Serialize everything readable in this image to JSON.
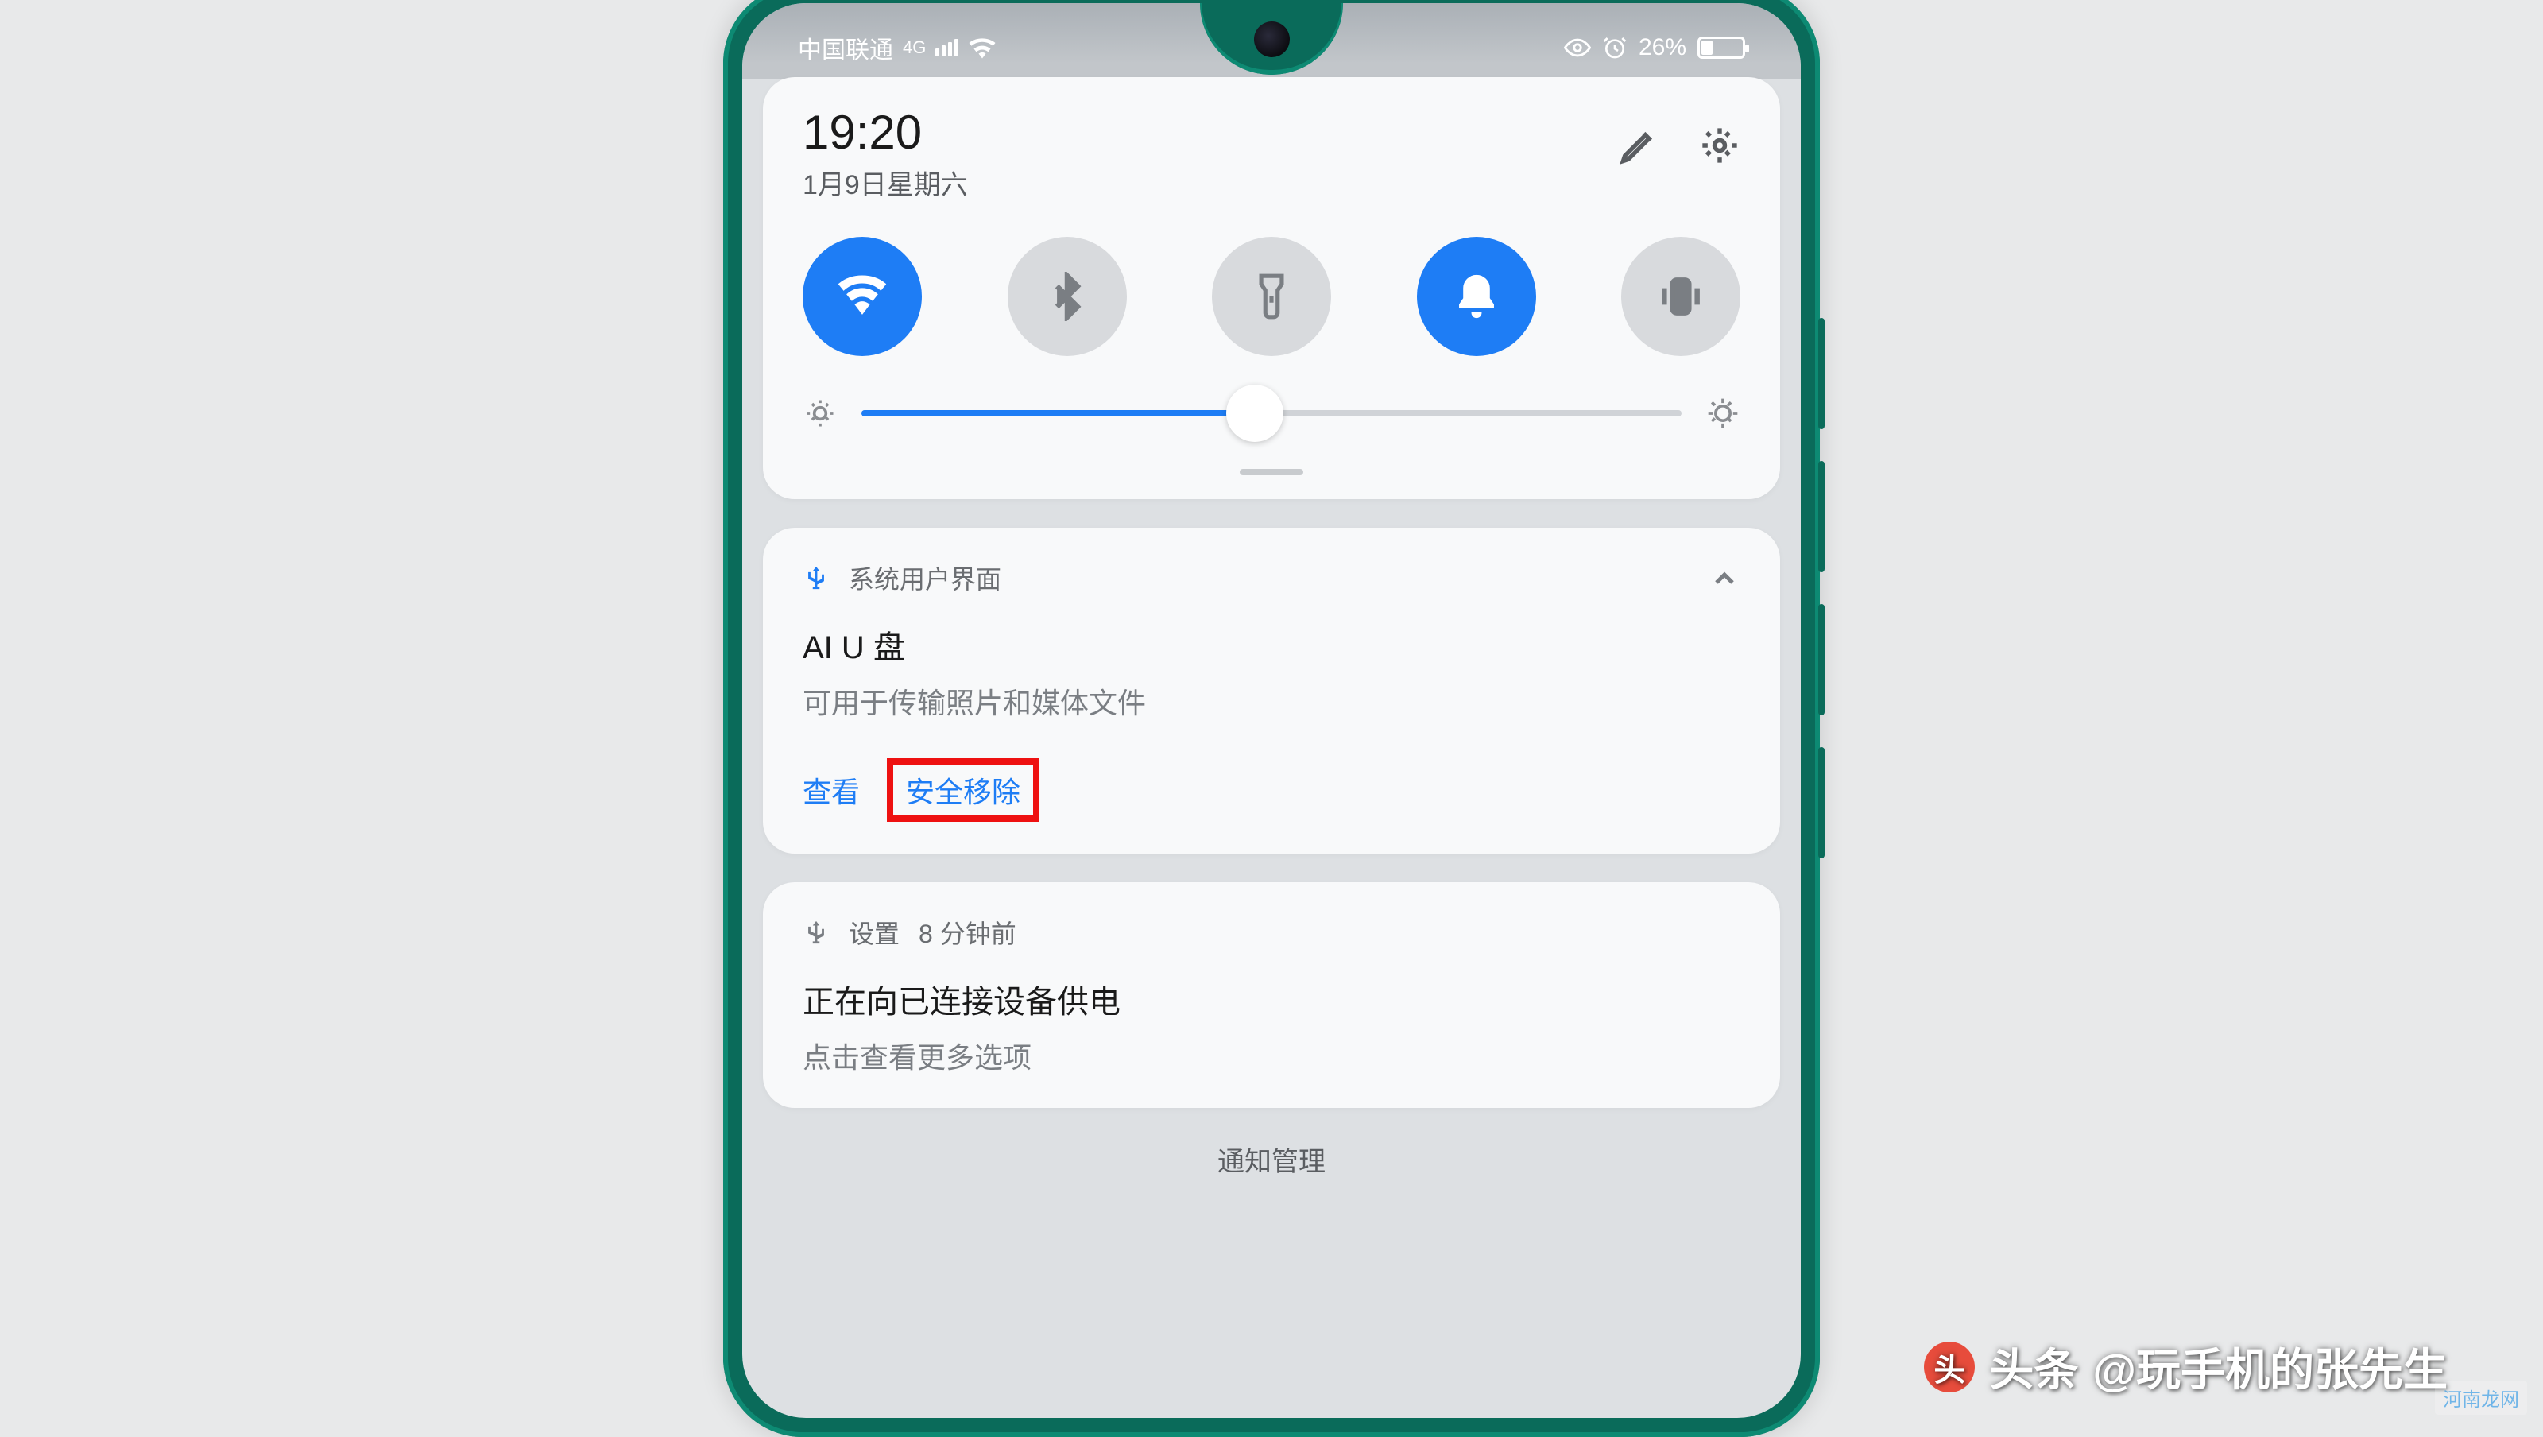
{
  "status": {
    "carrier": "中国联通",
    "network": "4G",
    "battery_pct": "26%"
  },
  "header": {
    "time": "19:20",
    "date": "1月9日星期六"
  },
  "toggles": {
    "wifi": "wifi",
    "bt": "bluetooth",
    "torch": "flashlight",
    "bell": "notifications",
    "vibrate": "vibrate"
  },
  "notif1": {
    "app": "系统用户界面",
    "title": "AI U 盘",
    "subtitle": "可用于传输照片和媒体文件",
    "view": "查看",
    "eject": "安全移除"
  },
  "notif2": {
    "app": "设置",
    "time": "8 分钟前",
    "title": "正在向已连接设备供电",
    "subtitle": "点击查看更多选项"
  },
  "footer": "通知管理",
  "watermark": {
    "prefix": "头条",
    "handle": "@玩手机的张先生"
  },
  "corner": "河南龙网"
}
